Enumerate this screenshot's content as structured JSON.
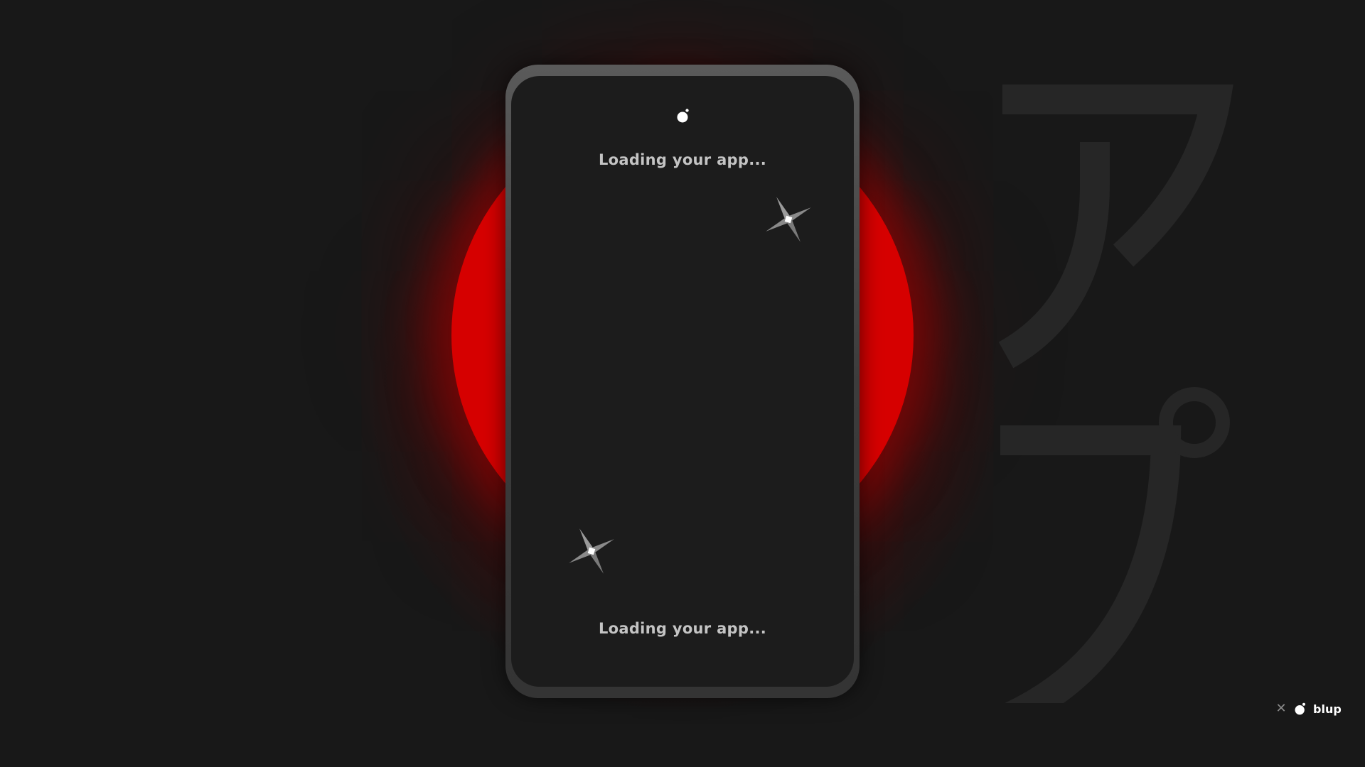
{
  "background_color": "#181818",
  "accent_color": "#d60000",
  "decor": {
    "sun": "red-sun",
    "katakana": "アプ"
  },
  "phone": {
    "logo_icon": "blup-logo-icon",
    "loading_top": "Loading your app...",
    "loading_bottom": "Loading your app...",
    "sparkle_icon": "sparkle-icon"
  },
  "badge": {
    "close_icon": "close-icon",
    "logo_icon": "blup-logo-icon",
    "label": "blup"
  }
}
